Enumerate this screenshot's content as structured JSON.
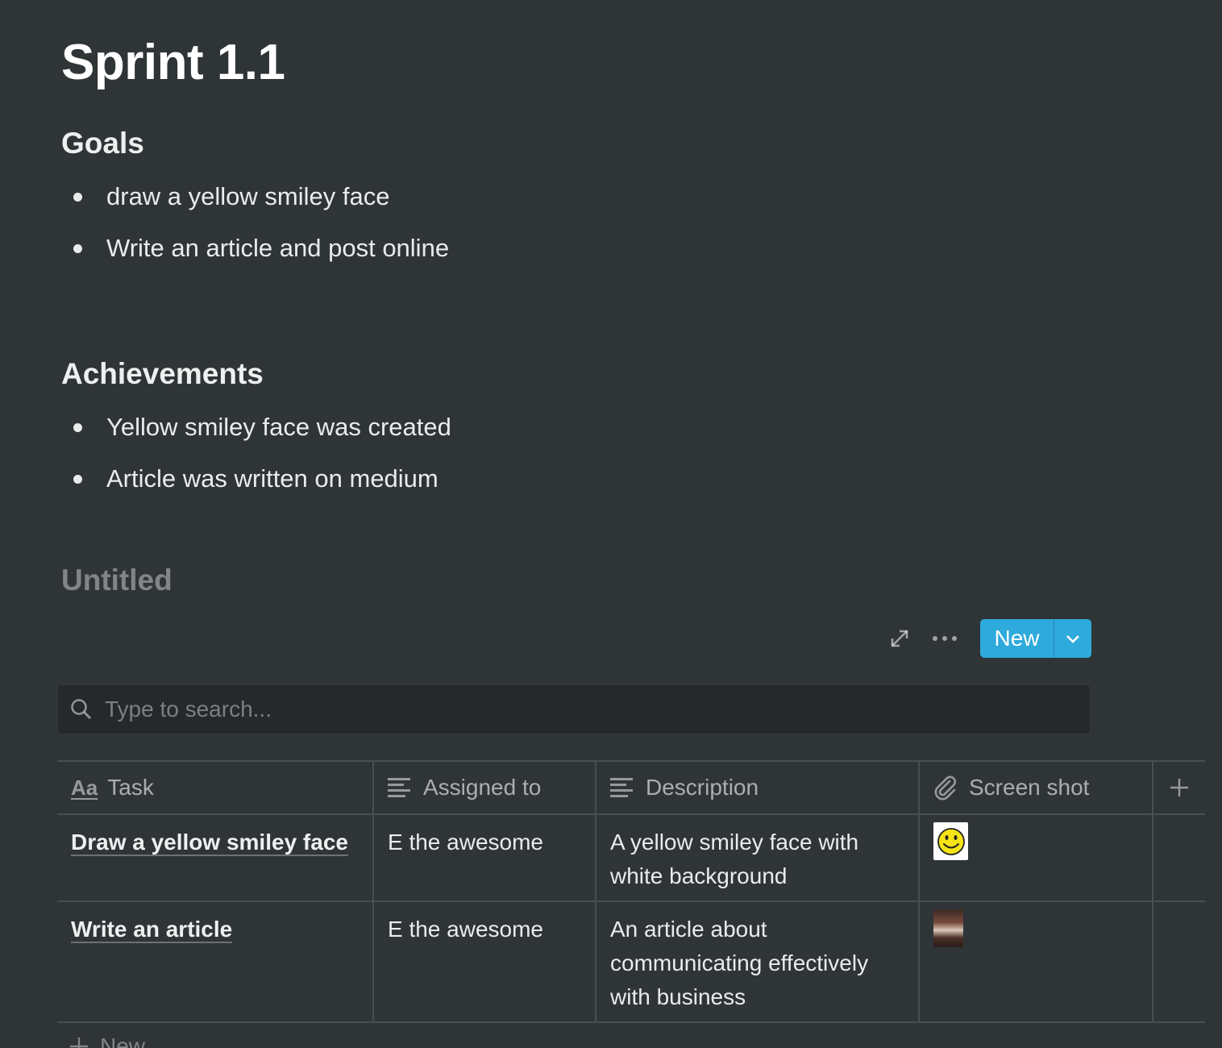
{
  "page": {
    "title": "Sprint 1.1"
  },
  "goals": {
    "heading": "Goals",
    "items": [
      "draw a yellow smiley face",
      "Write an article and post online"
    ]
  },
  "achievements": {
    "heading": "Achievements",
    "items": [
      "Yellow smiley face was created",
      "Article was written on medium"
    ]
  },
  "database": {
    "title": "Untitled",
    "new_button_label": "New",
    "search_placeholder": "Type to search...",
    "columns": {
      "task": "Task",
      "assigned": "Assigned to",
      "description": "Description",
      "screenshot": "Screen shot",
      "task_icon_text": "Aa"
    },
    "rows": [
      {
        "task": "Draw a yellow smiley face",
        "assigned": "E the awesome",
        "description_lines": [
          "A yellow smiley face with",
          "white background"
        ],
        "screenshot": "smiley-thumbnail"
      },
      {
        "task": "Write an article",
        "assigned": "E the awesome",
        "description_lines": [
          "An article about",
          "communicating effectively",
          "with business"
        ],
        "screenshot": "photo-thumbnail"
      }
    ],
    "add_row_label": "New"
  },
  "colors": {
    "background": "#2f3437",
    "accent": "#2eaadc",
    "search_bg": "#25292c"
  }
}
